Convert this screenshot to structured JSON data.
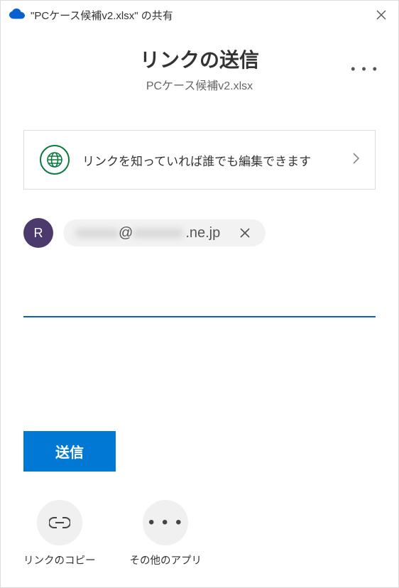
{
  "titlebar": {
    "title": "\"PCケース候補v2.xlsx\" の共有"
  },
  "header": {
    "title": "リンクの送信",
    "subtitle": "PCケース候補v2.xlsx"
  },
  "permission": {
    "text": "リンクを知っていれば誰でも編集できます"
  },
  "recipient": {
    "initial": "R",
    "masked_local": "xxxxxx",
    "at": "@",
    "masked_host": "xxxxxxx",
    "domain_suffix": ".ne.jp"
  },
  "send": {
    "label": "送信"
  },
  "actions": {
    "copy": "リンクのコピー",
    "other": "その他のアプリ"
  }
}
